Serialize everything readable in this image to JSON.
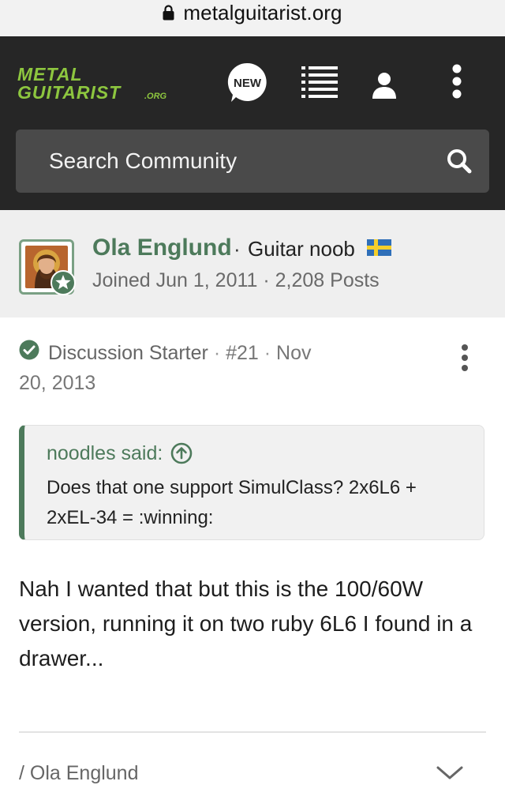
{
  "browser": {
    "url": "metalguitarist.org"
  },
  "header": {
    "logo_line1": "METAL",
    "logo_line2": "GUITARIST",
    "logo_suffix": ".ORG",
    "new_label": "NEW",
    "accent_color": "#8dc63f"
  },
  "search": {
    "placeholder": "Search Community"
  },
  "author": {
    "name": "Ola Englund",
    "separator": "·",
    "title": "Guitar noob",
    "flag": "sweden-flag",
    "meta": "Joined Jun 1, 2011 · 2,208 Posts"
  },
  "post": {
    "starter_label": "Discussion Starter",
    "number": "#21",
    "date_part1": "Nov",
    "date_part2": "20, 2013",
    "quote": {
      "author": "noodles said:",
      "text": "Does that one support SimulClass? 2x6L6 + 2xEL-34 = :winning:"
    },
    "body": "Nah I wanted that but this is the 100/60W version, running it on two ruby 6L6 I found in a drawer...",
    "signature": "/ Ola Englund"
  },
  "colors": {
    "brand_green": "#4d7a5b",
    "header_bg": "#262626",
    "search_bg": "#4a4a4a"
  }
}
